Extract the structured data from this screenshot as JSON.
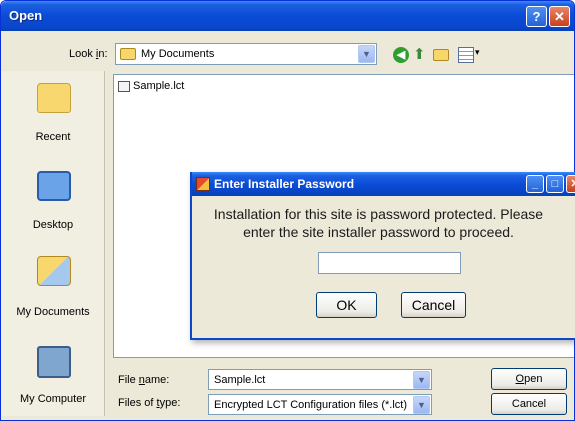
{
  "open_dialog": {
    "title": "Open",
    "help_glyph": "?",
    "close_glyph": "✕",
    "look_in_label_pre": "Look ",
    "look_in_label_key": "i",
    "look_in_label_post": "n:",
    "look_in_value": "My Documents",
    "toolbar_icons": [
      "back-icon",
      "up-folder-icon",
      "new-folder-icon",
      "views-icon"
    ],
    "places": [
      {
        "label": "Recent",
        "icon": "recent-icon"
      },
      {
        "label": "Desktop",
        "icon": "desktop-icon"
      },
      {
        "label": "My Documents",
        "icon": "my-documents-icon"
      },
      {
        "label": "My Computer",
        "icon": "my-computer-icon"
      }
    ],
    "files": [
      {
        "name": "Sample.lct"
      }
    ],
    "file_name_label_pre": "File ",
    "file_name_label_key": "n",
    "file_name_label_post": "ame:",
    "file_name_value": "Sample.lct",
    "file_type_label_pre": "Files of ",
    "file_type_label_key": "t",
    "file_type_label_post": "ype:",
    "file_type_value": "Encrypted LCT Configuration files (*.lct)",
    "open_button_key": "O",
    "open_button_rest": "pen",
    "cancel_button": "Cancel"
  },
  "password_dialog": {
    "title": "Enter Installer Password",
    "message": "Installation for this site is password protected.  Please enter the site installer password to proceed.",
    "password_value": "",
    "ok_button": "OK",
    "cancel_button": "Cancel"
  },
  "colors": {
    "titlebar_blue": "#0a4bd6",
    "dialog_face": "#ece9d8",
    "close_red": "#c8401b"
  }
}
